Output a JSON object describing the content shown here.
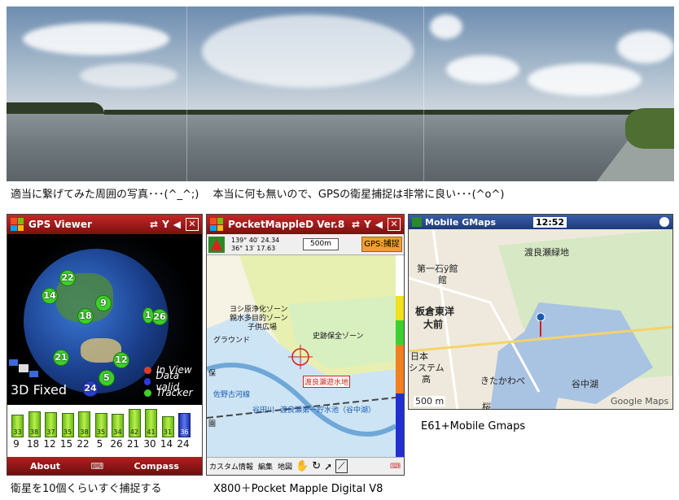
{
  "captions": {
    "panorama": "適当に繋げてみた周囲の写真･･･(^_^;)　 本当に何も無いので、GPSの衛星捕捉は非常に良い･･･(^o^)",
    "gps_viewer": "衛星を10個くらいすぐ捕捉する",
    "mapple": "X800＋Pocket Mapple Digital V8",
    "gmaps": "E61+Mobile Gmaps"
  },
  "gps_viewer": {
    "title": "GPS Viewer",
    "close": "✕",
    "status": "3D Fixed",
    "legend": [
      {
        "label": "In View",
        "color": "#e23a2a"
      },
      {
        "label": "Data valid",
        "color": "#2a3ae2"
      },
      {
        "label": "Tracker",
        "color": "#3ecf2c"
      }
    ],
    "satellites": [
      "22",
      "14",
      "9",
      "18",
      "26",
      "1",
      "21",
      "5",
      "12",
      "24"
    ],
    "signal_bars": {
      "prns": [
        "9",
        "18",
        "12",
        "15",
        "22",
        "5",
        "26",
        "21",
        "30",
        "14",
        "24"
      ],
      "values": [
        33,
        38,
        37,
        35,
        38,
        35,
        34,
        42,
        41,
        31,
        36
      ],
      "highlight_index": 10
    },
    "softkeys": {
      "left": "About",
      "right": "Compass"
    }
  },
  "mapple": {
    "title": "PocketMappleD Ver.8",
    "close": "✕",
    "longitude": "139° 40′ 24.34",
    "latitude": "36° 13′ 17.63",
    "scale": "500m",
    "capture_button": "GPS:捕捉",
    "map_labels": {
      "zone1": "ヨシ原浄化ゾーン",
      "zone2": "親水多目的ゾーン",
      "zone3": "子供広場",
      "ground": "グラウンド",
      "historic": "史跡保全ゾーン",
      "reservoir": "渡良瀬遊水地",
      "road": "佐野古河線",
      "yanaka": "谷田川",
      "lake": "渡良瀬第一貯水池（谷中湖）",
      "left_a": "保",
      "left_b": "園"
    },
    "menu": [
      "カスタム情報",
      "編集",
      "地図"
    ]
  },
  "gmaps": {
    "title": "Mobile GMaps",
    "time": "12:52",
    "labels": {
      "place1": "渡良瀬緑地",
      "school": "第一石ÿ館",
      "school_b": "館",
      "itakura": "板倉東洋",
      "itakura2": "大前",
      "system1": "日本",
      "system2": "システム",
      "system3": "高",
      "kitakawabe": "きたかわべ",
      "lake": "谷中湖",
      "scale": "500 m",
      "credit": "Google Maps",
      "bottom": "桜"
    }
  }
}
